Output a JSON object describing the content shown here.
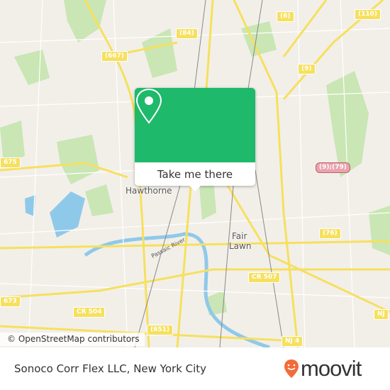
{
  "map": {
    "attribution": "© OpenStreetMap contributors",
    "places": [
      "Hawthorne",
      "Fair",
      "Lawn"
    ],
    "river_label": "Passaic River",
    "road_shields": [
      "(84)",
      "(667)",
      "(6)",
      "(110)",
      "(9)",
      "675",
      "(9);(79)",
      "(76)",
      "CR 507",
      "673",
      "CR 504",
      "(651)",
      "NJ 4",
      "NJ"
    ],
    "colors": {
      "land": "#f2efe9",
      "park": "#c9e6b4",
      "water": "#8fc9ea",
      "road": "#f6e05e"
    }
  },
  "popup": {
    "icon": "map-pin-icon",
    "button_label": "Take me there",
    "color": "#1fb96b"
  },
  "footer": {
    "title": "Sonoco Corr Flex LLC, New York City",
    "logo_text": "moovit",
    "logo_color": "#f26b3a"
  }
}
